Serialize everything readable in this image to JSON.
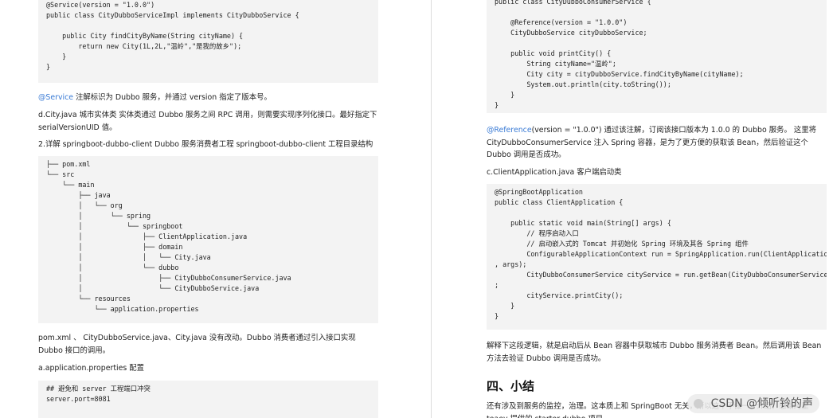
{
  "left": {
    "code1": "@Service(version = \"1.0.0\")\npublic class CityDubboServiceImpl implements CityDubboService {\n\n    public City findCityByName(String cityName) {\n        return new City(1L,2L,\"温岭\",\"是我的故乡\");\n    }\n}",
    "p1_anno": "@Service",
    "p1_text": " 注解标识为 Dubbo 服务，并通过 version 指定了版本号。",
    "p2": "d.City.java 城市实体类 实体类通过 Dubbo 服务之间 RPC 调用，则需要实现序列化接口。最好指定下 serialVersionUID 值。",
    "p3": "2.详解 springboot-dubbo-client Dubbo 服务消费者工程 springboot-dubbo-client 工程目录结构",
    "tree": "├── pom.xml\n└── src\n    └── main\n        ├── java\n        │   └── org\n        │       └── spring\n        │           └── springboot\n        │               ├── ClientApplication.java\n        │               ├── domain\n        │               │   └── City.java\n        │               └── dubbo\n        │                   ├── CityDubboConsumerService.java\n        │                   └── CityDubboService.java\n        └── resources\n            └── application.properties",
    "p4": "pom.xml 、 CityDubboService.java、City.java 没有改动。Dubbo 消费者通过引入接口实现 Dubbo 接口的调用。",
    "p5": "a.application.properties 配置",
    "code3": "## 避免和 server 工程端口冲突\nserver.port=8081"
  },
  "right": {
    "code1": "public class CityDubboConsumerService {\n\n    @Reference(version = \"1.0.0\")\n    CityDubboService cityDubboService;\n\n    public void printCity() {\n        String cityName=\"温岭\";\n        City city = cityDubboService.findCityByName(cityName);\n        System.out.println(city.toString());\n    }\n}",
    "p1_anno": "@Reference",
    "p1_text": "(version = \"1.0.0\") 通过该注解，订阅该接口版本为 1.0.0 的 Dubbo 服务。 这里将 CityDubboConsumerService 注入 Spring 容器，是为了更方便的获取该 Bean，然后验证这个 Dubbo 调用是否成功。",
    "p2": "c.ClientApplication.java 客户端启动类",
    "code2": "@SpringBootApplication\npublic class ClientApplication {\n\n    public static void main(String[] args) {\n        // 程序启动入口\n        // 启动嵌入式的 Tomcat 并初始化 Spring 环境及其各 Spring 组件\n        ConfigurableApplicationContext run = SpringApplication.run(ClientApplication.class\n, args);\n        CityDubboConsumerService cityService = run.getBean(CityDubboConsumerService.class)\n;\n        cityService.printCity();\n    }\n}",
    "p3": "解释下这段逻辑，就是启动后从 Bean 容器中获取城市 Dubbo 服务消费者 Bean。然后调用该 Bean 方法去验证 Dubbo 调用是否成功。",
    "heading": "四、小结",
    "p4": "还有涉及到服务的监控，治理。这本质上和 SpringBoot 无关，所以这个不做一一介绍。感谢阿里 teaey 提供的 starter-dubbo 项目。"
  },
  "watermark": "CSDN @倾听铃的声"
}
